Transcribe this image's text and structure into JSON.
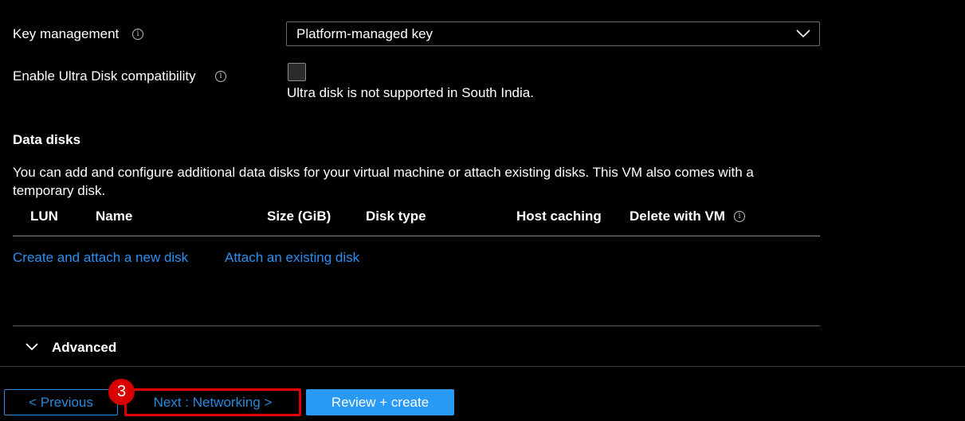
{
  "key_management": {
    "label": "Key management",
    "info_glyph": "i",
    "selected_value": "Platform-managed key"
  },
  "ultra_disk": {
    "label": "Enable Ultra Disk compatibility",
    "info_glyph": "i",
    "checked": false,
    "note": "Ultra disk is not supported in South India."
  },
  "data_disks": {
    "title": "Data disks",
    "description": "You can add and configure additional data disks for your virtual machine or attach existing disks. This VM also comes with a temporary disk.",
    "columns": [
      "LUN",
      "Name",
      "Size (GiB)",
      "Disk type",
      "Host caching",
      "Delete with VM"
    ],
    "delete_info_glyph": "i",
    "rows": [],
    "create_link": "Create and attach a new disk",
    "attach_link": "Attach an existing disk"
  },
  "advanced": {
    "label": "Advanced",
    "expanded": false
  },
  "footer": {
    "previous_label": "< Previous",
    "next_label": "Next : Networking >",
    "review_label": "Review + create",
    "step_badge": "3"
  },
  "colors": {
    "background": "#000000",
    "link": "#2d8ff0",
    "primary_button": "#2899f5",
    "highlight_box": "#e00000",
    "badge": "#d90000"
  }
}
